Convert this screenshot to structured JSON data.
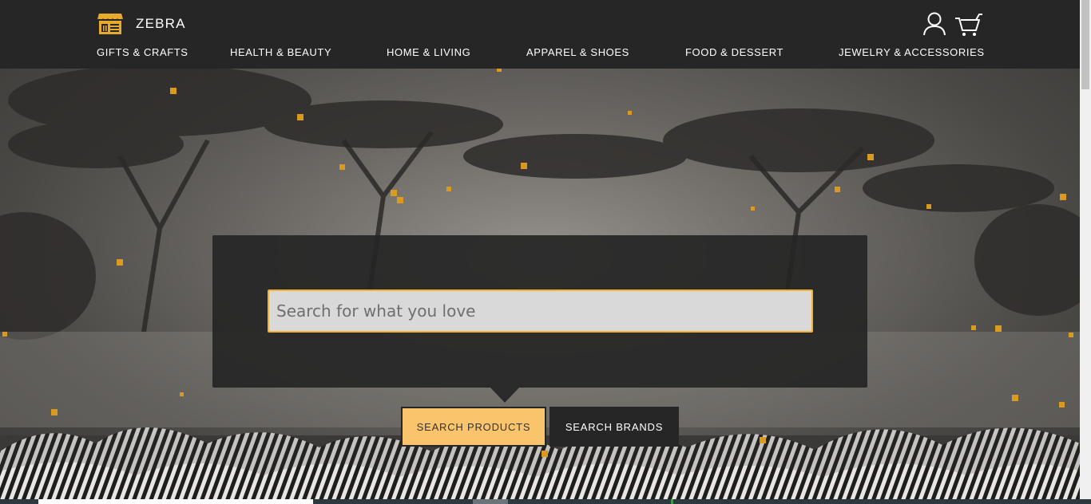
{
  "header": {
    "brand_name": "ZEBRA",
    "logo_icon": "storefront-icon",
    "account_icon": "user-icon",
    "cart_icon": "cart-icon",
    "nav": [
      {
        "label": "GIFTS & CRAFTS"
      },
      {
        "label": "HEALTH & BEAUTY"
      },
      {
        "label": "HOME & LIVING"
      },
      {
        "label": "APPAREL & SHOES"
      },
      {
        "label": "FOOD & DESSERT"
      },
      {
        "label": "JEWELRY & ACCESSORIES"
      }
    ]
  },
  "search": {
    "placeholder": "Search for what you love",
    "value": "",
    "tabs": {
      "products": "SEARCH PRODUCTS",
      "brands": "SEARCH BRANDS"
    },
    "active_tab": "products"
  },
  "colors": {
    "accent": "#f2b233",
    "active_tab_bg": "#f9c46b",
    "header_bg": "#262626"
  }
}
